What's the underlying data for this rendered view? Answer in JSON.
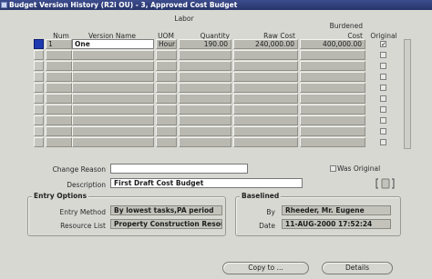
{
  "window": {
    "title": "Budget Version History (R2i OU) - 3, Approved Cost Budget"
  },
  "grid": {
    "group_header": "Labor",
    "columns": {
      "num": "Num",
      "version_name": "Version Name",
      "uom": "UOM",
      "quantity": "Quantity",
      "raw_cost": "Raw Cost",
      "burdened_cost_line1": "Burdened",
      "burdened_cost_line2": "Cost",
      "original": "Original"
    },
    "rows": [
      {
        "num": "1",
        "version_name": "One",
        "uom": "Hour",
        "quantity": "190.00",
        "raw_cost": "240,000.00",
        "burdened_cost": "400,000.00",
        "original": "✓"
      }
    ]
  },
  "detail": {
    "change_reason_label": "Change Reason",
    "change_reason_value": "",
    "was_original_label": "Was Original",
    "description_label": "Description",
    "description_value": "First Draft Cost Budget",
    "attach_icon": "bracket-button-icon"
  },
  "entry_options": {
    "title": "Entry Options",
    "entry_method_label": "Entry Method",
    "entry_method_value": "By lowest tasks,PA period",
    "resource_list_label": "Resource List",
    "resource_list_value": "Property Construction Resourc"
  },
  "baselined": {
    "title": "Baselined",
    "by_label": "By",
    "by_value": "Rheeder, Mr. Eugene",
    "date_label": "Date",
    "date_value": "11-AUG-2000 17:52:24"
  },
  "buttons": {
    "copy_to": "Copy to ...",
    "details": "Details"
  }
}
